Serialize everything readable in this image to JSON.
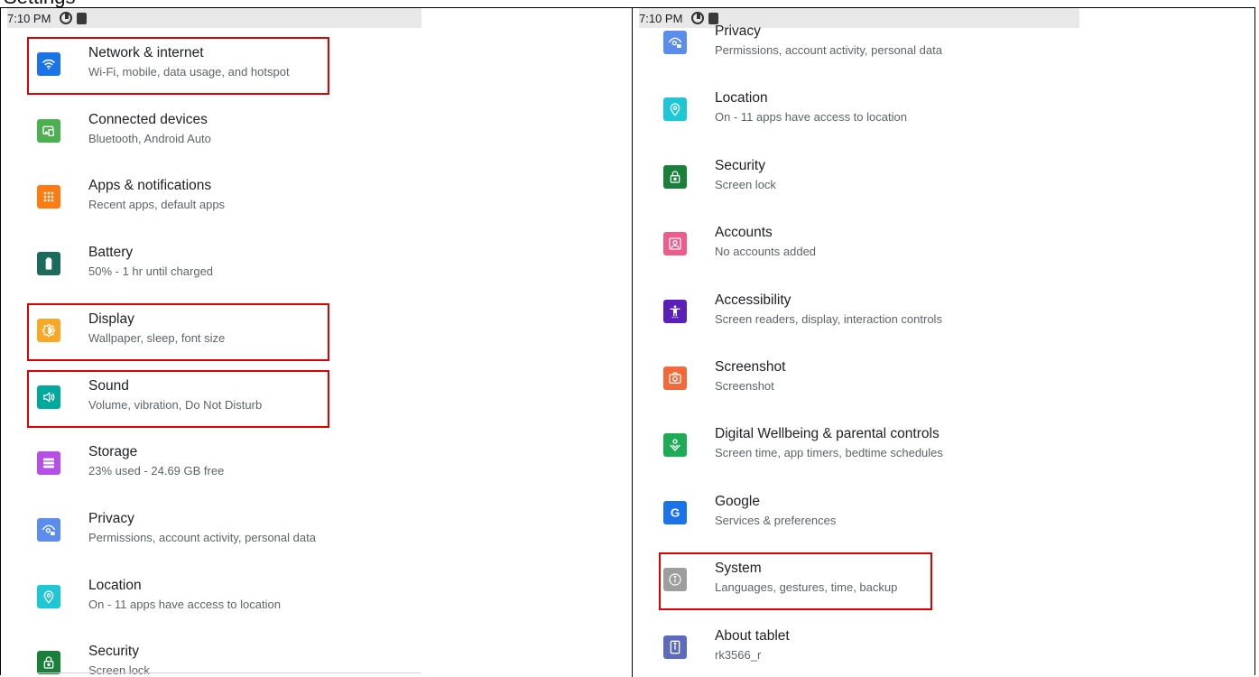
{
  "top_caption": "Settings",
  "left": {
    "status_time": "7:10 PM",
    "items": [
      {
        "title": "Network & internet",
        "subtitle": "Wi-Fi, mobile, data usage, and hotspot",
        "icon": "wifi-icon",
        "color": "#1a73e8",
        "highlighted": true
      },
      {
        "title": "Connected devices",
        "subtitle": "Bluetooth, Android Auto",
        "icon": "devices-icon",
        "color": "#4caf50",
        "highlighted": false
      },
      {
        "title": "Apps & notifications",
        "subtitle": "Recent apps, default apps",
        "icon": "apps-icon",
        "color": "#ff7b12",
        "highlighted": false
      },
      {
        "title": "Battery",
        "subtitle": "50% - 1 hr until charged",
        "icon": "battery-icon",
        "color": "#1b6b5a",
        "highlighted": false
      },
      {
        "title": "Display",
        "subtitle": "Wallpaper, sleep, font size",
        "icon": "brightness-icon",
        "color": "#f9a825",
        "highlighted": true
      },
      {
        "title": "Sound",
        "subtitle": "Volume, vibration, Do Not Disturb",
        "icon": "volume-icon",
        "color": "#00a99d",
        "highlighted": true
      },
      {
        "title": "Storage",
        "subtitle": "23% used - 24.69 GB free",
        "icon": "storage-icon",
        "color": "#b64ee8",
        "highlighted": false
      },
      {
        "title": "Privacy",
        "subtitle": "Permissions, account activity, personal data",
        "icon": "privacy-icon",
        "color": "#5b8def",
        "highlighted": false
      },
      {
        "title": "Location",
        "subtitle": "On - 11 apps have access to location",
        "icon": "location-icon",
        "color": "#1ec7d6",
        "highlighted": false
      },
      {
        "title": "Security",
        "subtitle": "Screen lock",
        "icon": "lock-icon",
        "color": "#188038",
        "highlighted": false
      }
    ]
  },
  "right": {
    "status_time": "7:10 PM",
    "items": [
      {
        "title": "Privacy",
        "subtitle": "Permissions, account activity, personal data",
        "icon": "privacy-icon",
        "color": "#5b8def",
        "highlighted": false
      },
      {
        "title": "Location",
        "subtitle": "On - 11 apps have access to location",
        "icon": "location-icon",
        "color": "#1ec7d6",
        "highlighted": false
      },
      {
        "title": "Security",
        "subtitle": "Screen lock",
        "icon": "lock-icon",
        "color": "#188038",
        "highlighted": false
      },
      {
        "title": "Accounts",
        "subtitle": "No accounts added",
        "icon": "account-icon",
        "color": "#ef5b8c",
        "highlighted": false
      },
      {
        "title": "Accessibility",
        "subtitle": "Screen readers, display, interaction controls",
        "icon": "accessibility-icon",
        "color": "#5a1fb8",
        "highlighted": false
      },
      {
        "title": "Screenshot",
        "subtitle": "Screenshot",
        "icon": "camera-icon",
        "color": "#f4693a",
        "highlighted": false
      },
      {
        "title": "Digital Wellbeing & parental controls",
        "subtitle": "Screen time, app timers, bedtime schedules",
        "icon": "wellbeing-icon",
        "color": "#1faa55",
        "highlighted": false
      },
      {
        "title": "Google",
        "subtitle": "Services & preferences",
        "icon": "google-icon",
        "color": "#1a73e8",
        "highlighted": false
      },
      {
        "title": "System",
        "subtitle": "Languages, gestures, time, backup",
        "icon": "info-icon",
        "color": "#9e9e9e",
        "highlighted": true
      },
      {
        "title": "About tablet",
        "subtitle": "rk3566_r",
        "icon": "tablet-icon",
        "color": "#5c6bc0",
        "highlighted": false
      }
    ]
  }
}
